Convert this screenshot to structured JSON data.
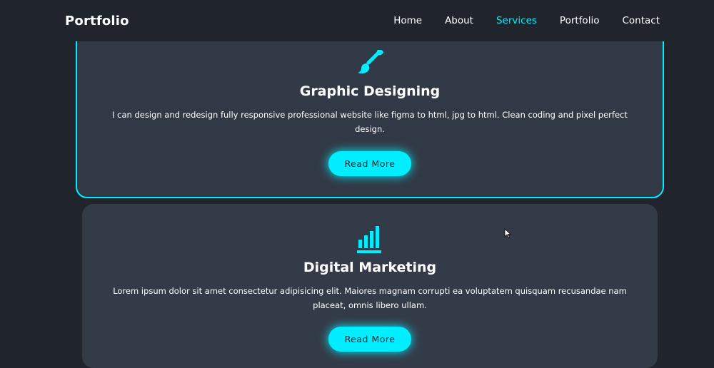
{
  "header": {
    "logo": "Portfolio",
    "nav": [
      "Home",
      "About",
      "Services",
      "Portfolio",
      "Contact"
    ],
    "active_index": 2
  },
  "services": [
    {
      "icon": "paintbrush-icon",
      "title": "Graphic Designing",
      "description": "I can design and redesign fully responsive professional website like figma to html, jpg to html. Clean coding and pixel perfect design.",
      "button": "Read More"
    },
    {
      "icon": "bar-chart-icon",
      "title": "Digital Marketing",
      "description": "Lorem ipsum dolor sit amet consectetur adipisicing elit. Maiores magnam corrupti ea voluptatem quisquam recusandae nam placeat, omnis libero ullam.",
      "button": "Read More"
    }
  ],
  "colors": {
    "background": "#1f242d",
    "card": "#323946",
    "accent": "#00eeff",
    "text": "#ffffff"
  }
}
